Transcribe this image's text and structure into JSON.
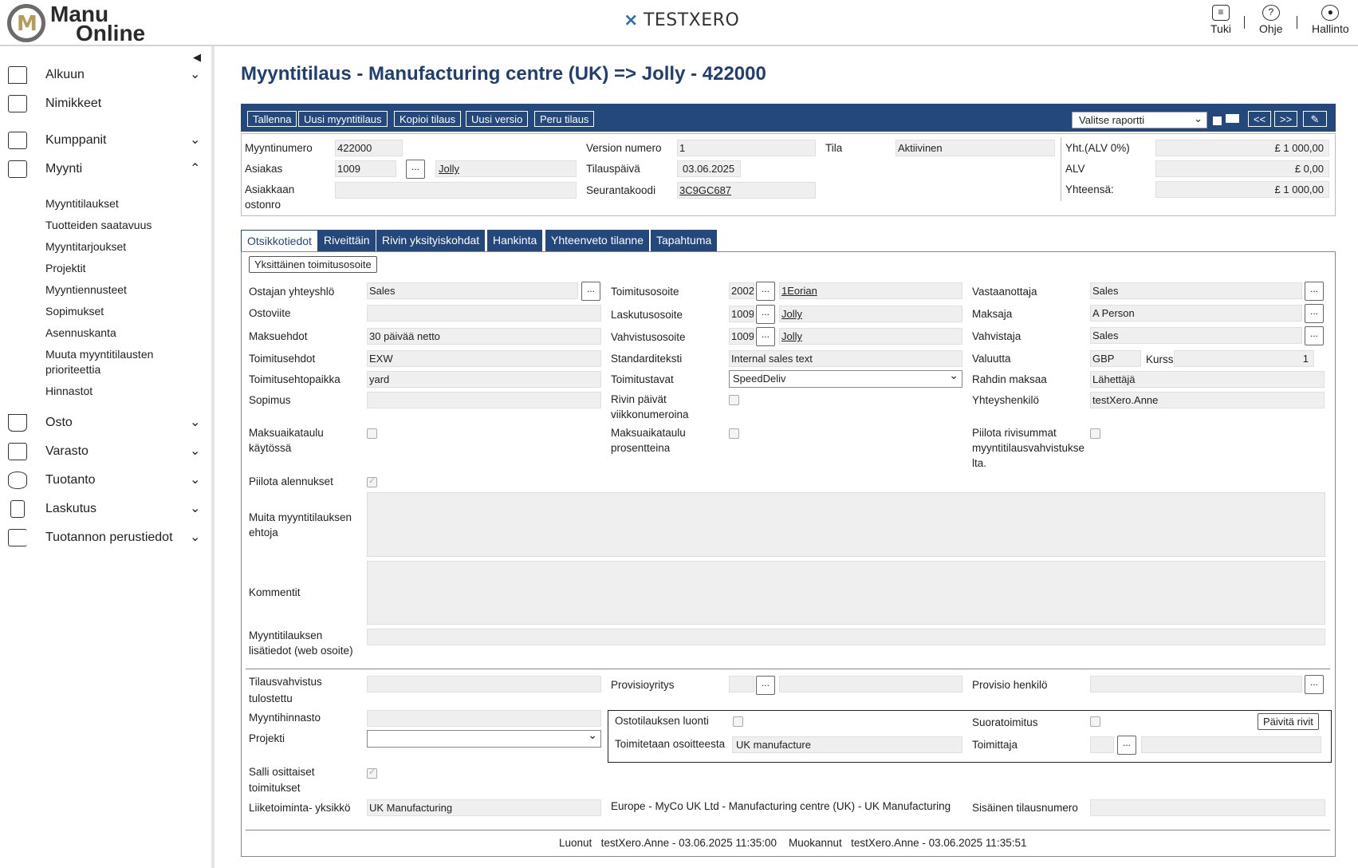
{
  "brand": {
    "logo_line1": "Manu",
    "logo_line2": "Online",
    "logo_mark": "M",
    "company": "TESTXERO"
  },
  "top_links": [
    {
      "label": "Tuki",
      "icon": "chat-icon"
    },
    {
      "label": "Ohje",
      "icon": "help-icon"
    },
    {
      "label": "Hallinto",
      "icon": "user-icon"
    }
  ],
  "sidebar": {
    "items": [
      {
        "label": "Alkuun"
      },
      {
        "label": "Nimikkeet"
      },
      {
        "label": "Kumppanit"
      },
      {
        "label": "Myynti"
      },
      {
        "label": "Osto"
      },
      {
        "label": "Varasto"
      },
      {
        "label": "Tuotanto"
      },
      {
        "label": "Laskutus"
      },
      {
        "label": "Tuotannon perustiedot"
      }
    ],
    "sub": [
      "Myyntitilaukset",
      "Tuotteiden saatavuus",
      "Myyntitarjoukset",
      "Projektit",
      "Myyntiennusteet",
      "Sopimukset",
      "Asennuskanta",
      "Muuta myyntitilausten prioriteettia",
      "Hinnastot"
    ]
  },
  "page_title": "Myyntitilaus - Manufacturing centre (UK) => Jolly - 422000",
  "toolbar": {
    "buttons": [
      "Tallenna",
      "Uusi myyntitilaus",
      "Kopioi tilaus",
      "Uusi versio",
      "Peru tilaus"
    ],
    "report_select": "Valitse raportti",
    "prev": "<<",
    "next": ">>"
  },
  "header": {
    "myyntinumero_label": "Myyntinumero",
    "myyntinumero": "422000",
    "asiakas_label": "Asiakas",
    "asiakas_code": "1009",
    "asiakas_name": "Jolly",
    "ostonro_label_1": "Asiakkaan",
    "ostonro_label_2": "ostonro",
    "ostonro": "",
    "version_label": "Version numero",
    "version": "1",
    "tilauspaiva_label": "Tilauspäivä",
    "tilauspaiva": "03.06.2025",
    "seuranta_label": "Seurantakoodi",
    "seuranta": "3C9GC687",
    "tila_label": "Tila",
    "tila": "Aktiivinen",
    "yht_label": "Yht.(ALV 0%)",
    "yht": "£ 1 000,00",
    "alv_label": "ALV",
    "alv": "£ 0,00",
    "yhteensa_label": "Yhteensä:",
    "yhteensa": "£ 1 000,00"
  },
  "tabs": [
    "Otsikkotiedot",
    "Riveittäin",
    "Rivin yksityiskohdat",
    "Hankinta",
    "Yhteenveto tilanne",
    "Tapahtuma"
  ],
  "form": {
    "btn_address": "Yksittäinen toimitusosoite",
    "c1": {
      "ostajan_label": "Ostajan yhteyshlö",
      "ostajan": "Sales",
      "ostoviite_label": "Ostoviite",
      "ostoviite": "",
      "maksuehdot_label": "Maksuehdot",
      "maksuehdot": "30 päivää netto",
      "toimitusehdot_label": "Toimitusehdot",
      "toimitusehdot": "EXW",
      "tpaikka_label": "Toimitusehtopaikka",
      "tpaikka": "yard",
      "sopimus_label": "Sopimus",
      "sopimus": "",
      "maksuaik_label_1": "Maksuaikataulu",
      "maksuaik_label_2": "käytössä",
      "piilota_ale_label": "Piilota alennukset"
    },
    "c2": {
      "toimitusosoite_label": "Toimitusosoite",
      "toimitusosoite_code": "2002",
      "toimitusosoite": "1Eorian",
      "laskutus_label": "Laskutusosoite",
      "laskutus_code": "1009",
      "laskutus": "Jolly",
      "vahvistus_label": "Vahvistusosoite",
      "vahvistus_code": "1009",
      "vahvistus": "Jolly",
      "standardi_label": "Standarditeksti",
      "standardi": "Internal sales text",
      "toimitustavat_label": "Toimitustavat",
      "toimitustavat": "SpeedDeliv",
      "rivinpv_label_1": "Rivin päivät",
      "rivinpv_label_2": "viikkonumeroina",
      "maksupros_label_1": "Maksuaikataulu",
      "maksupros_label_2": "prosentteina"
    },
    "c3": {
      "vastaanottaja_label": "Vastaanottaja",
      "vastaanottaja": "Sales",
      "maksaja_label": "Maksaja",
      "maksaja": "A Person",
      "vahvistaja_label": "Vahvistaja",
      "vahvistaja": "Sales",
      "valuutta_label": "Valuutta",
      "valuutta": "GBP",
      "kurssi_label": "Kurssi",
      "kurssi": "1",
      "rahti_label": "Rahdin maksaa",
      "rahti": "Lähettäjä",
      "yhteys_label": "Yhteyshenkilö",
      "yhteys": "testXero.Anne",
      "piilota_rivi_label_1": "Piilota rivisummat",
      "piilota_rivi_label_2": "myyntitilausvahvistukse",
      "piilota_rivi_label_3": "lta."
    },
    "muita_label_1": "Muita myyntitilauksen",
    "muita_label_2": "ehtoja",
    "kommentit_label": "Kommentit",
    "lisatiedot_label_1": "Myyntitilauksen",
    "lisatiedot_label_2": "lisätiedot (web osoite)",
    "tv_label_1": "Tilausvahvistus",
    "tv_label_2": "tulostettu",
    "provisio_label": "Provisioyritys",
    "provisio_hlo_label": "Provisio henkilö",
    "hinnasto_label": "Myyntihinnasto",
    "projekti_label": "Projekti",
    "ostotil_label": "Ostotilauksen luonti",
    "suora_label": "Suoratoimitus",
    "paivita_btn": "Päivitä rivit",
    "toimosoite_label": "Toimitetaan osoitteesta",
    "toimosoite": "UK manufacture",
    "toimittaja_label": "Toimittaja",
    "salli_label_1": "Salli osittaiset",
    "salli_label_2": "toimitukset",
    "lty_label": "Liiketoiminta- yksikkö",
    "lty": "UK Manufacturing",
    "lty_path": "Europe - MyCo UK Ltd - Manufacturing centre (UK) - UK Manufacturing",
    "sisainen_label": "Sisäinen tilausnumero"
  },
  "footer": {
    "luonut_label": "Luonut",
    "luonut": "testXero.Anne - 03.06.2025 11:35:00",
    "muokannut_label": "Muokannut",
    "muokannut": "testXero.Anne - 03.06.2025 11:35:51"
  }
}
